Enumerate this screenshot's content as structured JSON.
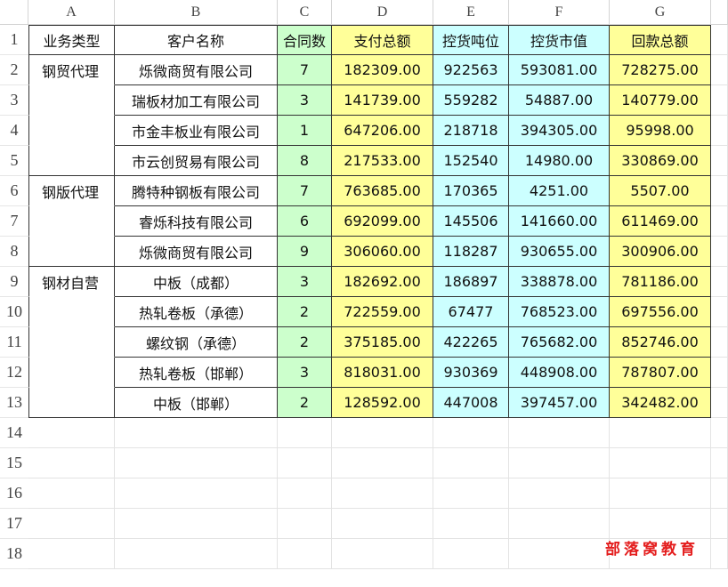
{
  "columns": [
    "A",
    "B",
    "C",
    "D",
    "E",
    "F",
    "G"
  ],
  "row_numbers": [
    "1",
    "2",
    "3",
    "4",
    "5",
    "6",
    "7",
    "8",
    "9",
    "10",
    "11",
    "12",
    "13",
    "14",
    "15",
    "16",
    "17",
    "18"
  ],
  "headers": [
    "业务类型",
    "客户名称",
    "合同数",
    "支付总额",
    "控货吨位",
    "控货市值",
    "回款总额"
  ],
  "rows": [
    [
      "钢贸代理",
      "烁微商贸有限公司",
      "7",
      "182309.00",
      "922563",
      "593081.00",
      "728275.00"
    ],
    [
      "",
      "瑞板材加工有限公司",
      "3",
      "141739.00",
      "559282",
      "54887.00",
      "140779.00"
    ],
    [
      "",
      "市金丰板业有限公司",
      "1",
      "647206.00",
      "218718",
      "394305.00",
      "95998.00"
    ],
    [
      "",
      "市云创贸易有限公司",
      "8",
      "217533.00",
      "152540",
      "14980.00",
      "330869.00"
    ],
    [
      "钢版代理",
      "腾特种钢板有限公司",
      "7",
      "763685.00",
      "170365",
      "4251.00",
      "5507.00"
    ],
    [
      "",
      "睿烁科技有限公司",
      "6",
      "692099.00",
      "145506",
      "141660.00",
      "611469.00"
    ],
    [
      "",
      "烁微商贸有限公司",
      "9",
      "306060.00",
      "118287",
      "930655.00",
      "300906.00"
    ],
    [
      "钢材自营",
      "中板（成都）",
      "3",
      "182692.00",
      "186897",
      "338878.00",
      "781186.00"
    ],
    [
      "",
      "热轧卷板（承德）",
      "2",
      "722559.00",
      "67477",
      "768523.00",
      "697556.00"
    ],
    [
      "",
      "螺纹钢（承德）",
      "2",
      "375185.00",
      "422265",
      "765682.00",
      "852746.00"
    ],
    [
      "",
      "热轧卷板（邯郸）",
      "3",
      "818031.00",
      "930369",
      "448908.00",
      "787807.00"
    ],
    [
      "",
      "中板（邯郸）",
      "2",
      "128592.00",
      "447008",
      "397457.00",
      "342482.00"
    ]
  ],
  "column_colors": [
    "#ffffff",
    "#ffffff",
    "#ccffcc",
    "#ffff99",
    "#ccffff",
    "#ccffff",
    "#ffff99"
  ],
  "watermark": "部落窝教育"
}
